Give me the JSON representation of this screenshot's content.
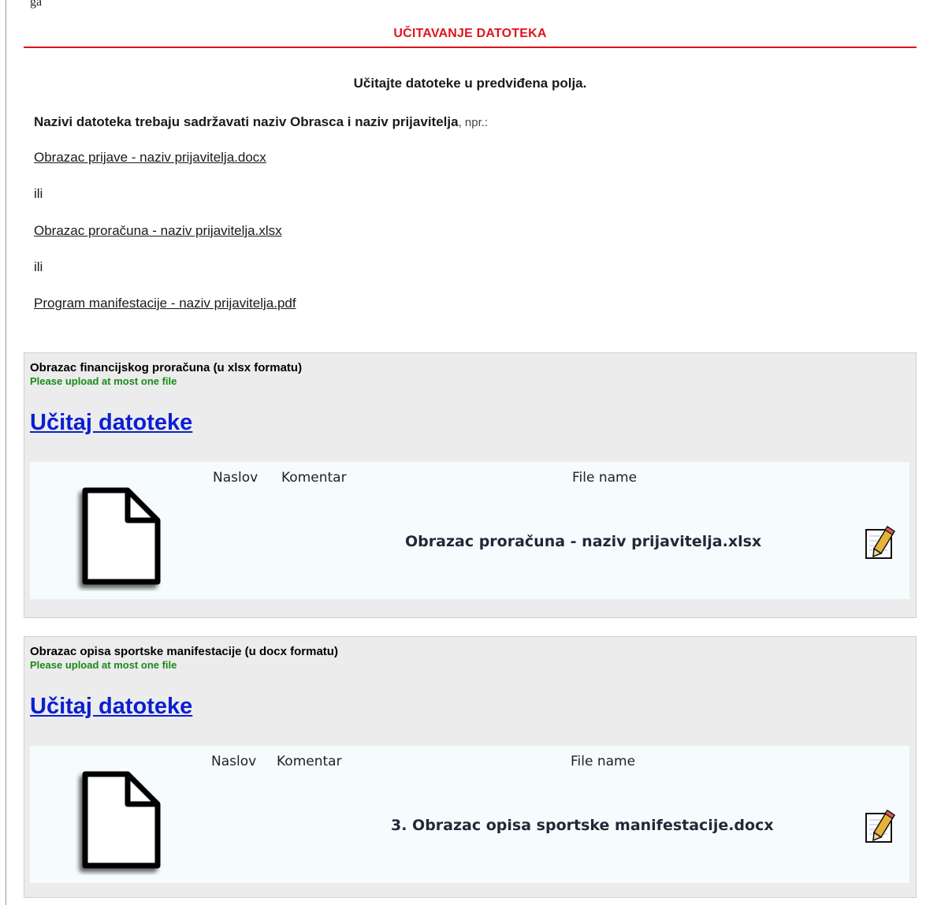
{
  "top_fragment": "ga",
  "section": {
    "title": "UČITAVANJE DATOTEKA"
  },
  "instructions": {
    "heading": "Učitajte datoteke u predviđena polja.",
    "naming_bold": "Nazivi datoteka trebaju sadržavati naziv Obrasca i naziv prijavitelja",
    "naming_suffix": ", npr.:",
    "example1": "Obrazac prijave - naziv prijavitelja.docx",
    "or1": "ili",
    "example2": "Obrazac proračuna - naziv prijavitelja.xlsx",
    "or2": "ili",
    "example3": "Program manifestacije - naziv prijavitelja.pdf"
  },
  "panels": [
    {
      "title": "Obrazac financijskog proračuna (u xlsx formatu)",
      "hint": "Please upload at most one file",
      "upload_label": "Učitaj datoteke",
      "columns": {
        "naslov": "Naslov",
        "komentar": "Komentar",
        "file_name": "File name"
      },
      "file": "Obrazac proračuna - naziv prijavitelja.xlsx"
    },
    {
      "title": "Obrazac opisa sportske manifestacije (u docx formatu)",
      "hint": "Please upload at most one file",
      "upload_label": "Učitaj datoteke",
      "columns": {
        "naslov": "Naslov",
        "komentar": "Komentar",
        "file_name": "File name"
      },
      "file": "3. Obrazac opisa sportske manifestacije.docx"
    }
  ],
  "icons": {
    "file": "document-icon",
    "edit": "edit-pencil-icon"
  },
  "colors": {
    "accent_red": "#e0141e",
    "hint_green": "#1a8a1a",
    "link_blue": "#0b1fd1",
    "panel_bg": "#ececec"
  }
}
